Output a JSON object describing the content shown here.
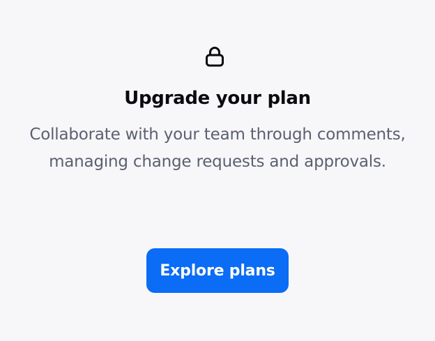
{
  "upgrade": {
    "icon": "lock-icon",
    "title": "Upgrade your plan",
    "description": "Collaborate with your team through comments, managing change requests and approvals.",
    "button_label": "Explore plans"
  },
  "colors": {
    "background": "#f7f7f9",
    "title": "#0b0b0f",
    "description": "#5b6071",
    "button": "#0b6cf5",
    "button_text": "#ffffff"
  }
}
